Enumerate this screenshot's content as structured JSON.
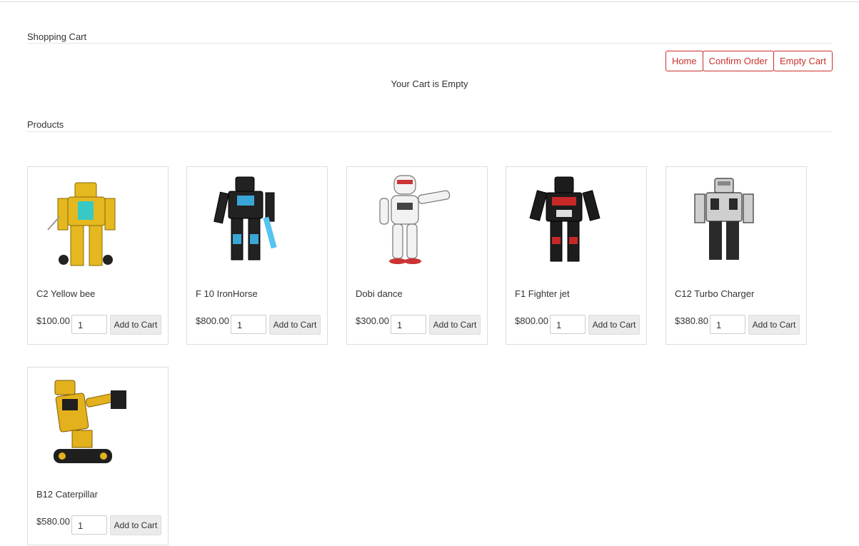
{
  "cart": {
    "title": "Shopping Cart",
    "buttons": {
      "home": "Home",
      "confirm": "Confirm Order",
      "empty": "Empty Cart"
    },
    "empty_message": "Your Cart is Empty"
  },
  "products": {
    "title": "Products",
    "add_label": "Add to Cart",
    "items": [
      {
        "name": "C2 Yellow bee",
        "price": "$100.00",
        "qty": "1"
      },
      {
        "name": "F 10 IronHorse",
        "price": "$800.00",
        "qty": "1"
      },
      {
        "name": "Dobi dance",
        "price": "$300.00",
        "qty": "1"
      },
      {
        "name": "F1 Fighter jet",
        "price": "$800.00",
        "qty": "1"
      },
      {
        "name": "C12 Turbo Charger",
        "price": "$380.80",
        "qty": "1"
      },
      {
        "name": "B12 Caterpillar",
        "price": "$580.00",
        "qty": "1"
      }
    ]
  },
  "colors": {
    "accent": "#c9302c",
    "button_bg": "#ebebeb",
    "border": "#dddddd"
  }
}
